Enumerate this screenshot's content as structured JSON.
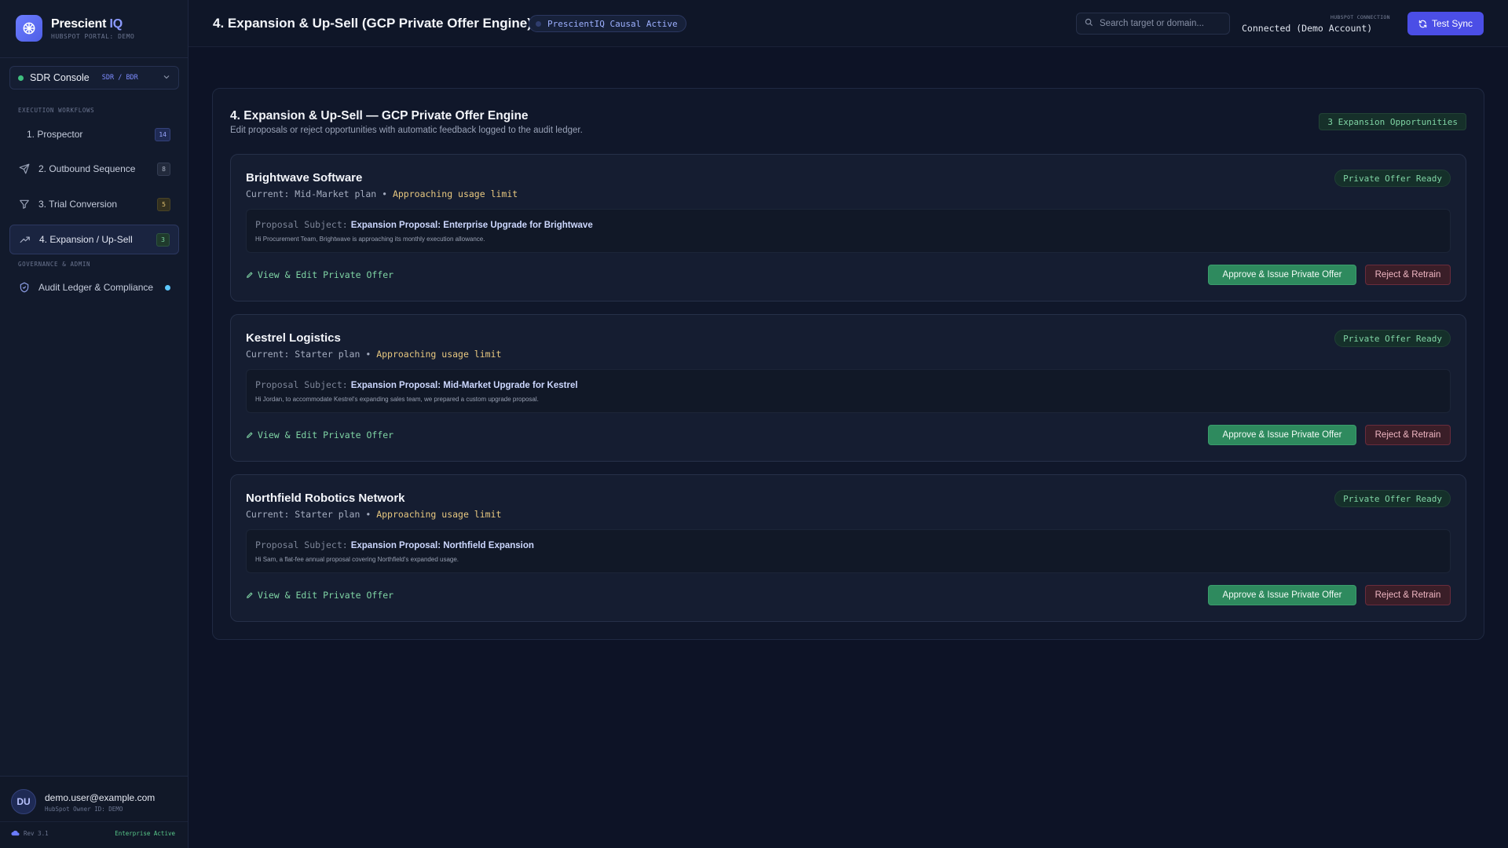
{
  "brand": {
    "name": "Prescient",
    "name_accent": "IQ",
    "portal": "HUBSPOT PORTAL: DEMO"
  },
  "console": {
    "label": "SDR Console",
    "role": "SDR / BDR"
  },
  "sidebar": {
    "section_execution": "EXECUTION WORKFLOWS",
    "section_governance": "GOVERNANCE & ADMIN",
    "items": [
      {
        "label": "1. Prospector",
        "badge": "14",
        "icon": "none"
      },
      {
        "label": "2. Outbound Sequence",
        "badge": "8",
        "icon": "send-icon"
      },
      {
        "label": "3. Trial Conversion",
        "badge": "5",
        "icon": "filter-icon"
      },
      {
        "label": "4. Expansion / Up-Sell",
        "badge": "3",
        "icon": "trending-up-icon"
      }
    ],
    "governance_items": [
      {
        "label": "Audit Ledger & Compliance",
        "icon": "shield-icon"
      }
    ]
  },
  "user": {
    "initials": "DU",
    "email": "demo.user@example.com",
    "owner_id": "HubSpot Owner ID: DEMO",
    "rev": "Rev 3.1",
    "plan": "Enterprise Active"
  },
  "header": {
    "title": "4. Expansion & Up-Sell (GCP Private Offer Engine)",
    "status": "PrescientIQ Causal Active",
    "search_placeholder": "Search target or domain...",
    "connection_label": "HUBSPOT CONNECTION",
    "connection_value": "Connected (Demo Account)",
    "sync_label": "Test Sync"
  },
  "panel": {
    "title": "4. Expansion & Up-Sell — GCP Private Offer Engine",
    "subtitle": "Edit proposals or reject opportunities with automatic feedback logged to the audit ledger.",
    "opportunity_count": "3 Expansion Opportunities"
  },
  "cards": [
    {
      "company": "Brightwave Software",
      "plan_prefix": "Current: Mid-Market plan •",
      "plan_status": "Approaching usage limit",
      "badge": "Private Offer Ready",
      "proposal_label": "Proposal Subject:",
      "proposal_subject": "Expansion Proposal: Enterprise Upgrade for Brightwave",
      "proposal_body": "Hi Procurement Team, Brightwave is approaching its monthly execution allowance.",
      "edit_label": "View & Edit Private Offer",
      "approve_label": "Approve & Issue Private Offer",
      "reject_label": "Reject & Retrain"
    },
    {
      "company": "Kestrel Logistics",
      "plan_prefix": "Current: Starter plan •",
      "plan_status": "Approaching usage limit",
      "badge": "Private Offer Ready",
      "proposal_label": "Proposal Subject:",
      "proposal_subject": "Expansion Proposal: Mid-Market Upgrade for Kestrel",
      "proposal_body": "Hi Jordan, to accommodate Kestrel's expanding sales team, we prepared a custom upgrade proposal.",
      "edit_label": "View & Edit Private Offer",
      "approve_label": "Approve & Issue Private Offer",
      "reject_label": "Reject & Retrain"
    },
    {
      "company": "Northfield Robotics Network",
      "plan_prefix": "Current: Starter plan •",
      "plan_status": "Approaching usage limit",
      "badge": "Private Offer Ready",
      "proposal_label": "Proposal Subject:",
      "proposal_subject": "Expansion Proposal: Northfield Expansion",
      "proposal_body": "Hi Sam, a flat-fee annual proposal covering Northfield's expanded usage.",
      "edit_label": "View & Edit Private Offer",
      "approve_label": "Approve & Issue Private Offer",
      "reject_label": "Reject & Retrain"
    }
  ],
  "colors": {
    "accent": "#4b4ee6",
    "success": "#2e8a5e",
    "danger": "#6a2c3c",
    "warning": "#e8c880"
  }
}
